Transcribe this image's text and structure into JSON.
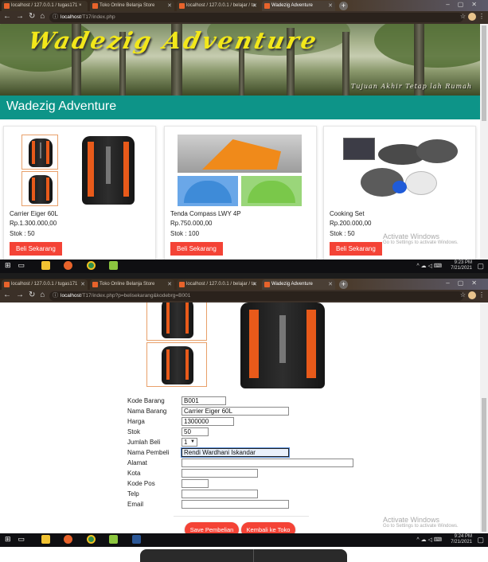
{
  "shot1": {
    "tabs": [
      {
        "label": "localhost / 127.0.0.1 / tugas171 ×"
      },
      {
        "label": "Toko Online Belanja Store"
      },
      {
        "label": "localhost / 127.0.0.1 / belajar / ta"
      },
      {
        "label": "Wadezig Adventure",
        "active": true
      }
    ],
    "url": {
      "host": "localhost",
      "path": "/T17/index.php"
    },
    "banner": {
      "title": "Wadezig Adventure",
      "subtitle": "Tujuan Akhir Tetap lah Rumah"
    },
    "navbar_brand": "Wadezig Adventure",
    "products": [
      {
        "name": "Carrier Eiger 60L",
        "price": "Rp.1.300.000,00",
        "stock": "Stok : 50",
        "button": "Beli Sekarang"
      },
      {
        "name": "Tenda Compass LWY 4P",
        "price": "Rp.750.000,00",
        "stock": "Stok : 100",
        "button": "Beli Sekarang"
      },
      {
        "name": "Cooking Set",
        "price": "Rp.200.000,00",
        "stock": "Stok : 50",
        "button": "Beli Sekarang"
      }
    ],
    "watermark": {
      "title": "Activate Windows",
      "subtitle": "Go to Settings to activate Windows."
    },
    "clock": {
      "time": "9:23 PM",
      "date": "7/21/2021"
    }
  },
  "shot2": {
    "tabs": [
      {
        "label": "localhost / 127.0.0.1 / tugas171"
      },
      {
        "label": "Toko Online Belanja Store"
      },
      {
        "label": "localhost / 127.0.0.1 / belajar / ta"
      },
      {
        "label": "Wadezig Adventure",
        "active": true
      }
    ],
    "url": {
      "host": "localhost",
      "path": "/T17/index.php?p=belisekarang&kodebrg=B001"
    },
    "form": {
      "kode_barang": {
        "label": "Kode Barang",
        "value": "B001"
      },
      "nama_barang": {
        "label": "Nama Barang",
        "value": "Carrier Eiger 60L"
      },
      "harga": {
        "label": "Harga",
        "value": "1300000"
      },
      "stok": {
        "label": "Stok",
        "value": "50"
      },
      "jumlah_beli": {
        "label": "Jumlah Beli",
        "value": "1"
      },
      "nama_pembeli": {
        "label": "Nama Pembeli",
        "value": "Rendi Wardhani Iskandar"
      },
      "alamat": {
        "label": "Alamat",
        "value": ""
      },
      "kota": {
        "label": "Kota",
        "value": ""
      },
      "kode_pos": {
        "label": "Kode Pos",
        "value": ""
      },
      "telp": {
        "label": "Telp",
        "value": ""
      },
      "email": {
        "label": "Email",
        "value": ""
      }
    },
    "buttons": {
      "save": "Save Pembelian",
      "back": "Kembali ke Toko"
    },
    "watermark": {
      "title": "Activate Windows",
      "subtitle": "Go to Settings to activate Windows."
    },
    "clock": {
      "time": "9:24 PM",
      "date": "7/21/2021"
    }
  },
  "colors": {
    "accent_teal": "#0d9488",
    "button_red": "#f44336",
    "banner_title": "#f2e71a"
  }
}
